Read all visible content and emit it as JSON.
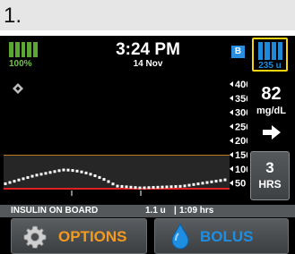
{
  "step": {
    "number": "1."
  },
  "status_bar": {
    "battery_percent": "100%",
    "battery_level": 1.0,
    "time": "3:24 PM",
    "date": "14 Nov",
    "bluetooth_label": "B",
    "insulin_units": "235 u",
    "insulin_level": 1.0
  },
  "graph": {
    "y_ticks": [
      "400",
      "350",
      "300",
      "250",
      "200",
      "150",
      "100",
      "50"
    ],
    "target_high": 180,
    "target_low": 70,
    "cgm_icon": "diamond-icon"
  },
  "reading": {
    "value": "82",
    "unit": "mg/dL",
    "trend_icon": "arrow-right-icon"
  },
  "hours_button": {
    "value": "3",
    "label": "HRS"
  },
  "iob": {
    "label": "INSULIN ON BOARD",
    "amount": "1.1 u",
    "separator": "|",
    "time": "1:09 hrs"
  },
  "buttons": {
    "options_label": "OPTIONS",
    "options_icon": "gear-icon",
    "bolus_label": "BOLUS",
    "bolus_icon": "drop-icon"
  },
  "colors": {
    "battery": "#5aa832",
    "insulin": "#1f8ad8",
    "highlight": "#f3d60d",
    "options": "#f39b1d",
    "bolus": "#1e8ee3",
    "high_line": "#f5a623",
    "low_line": "#e02020"
  }
}
